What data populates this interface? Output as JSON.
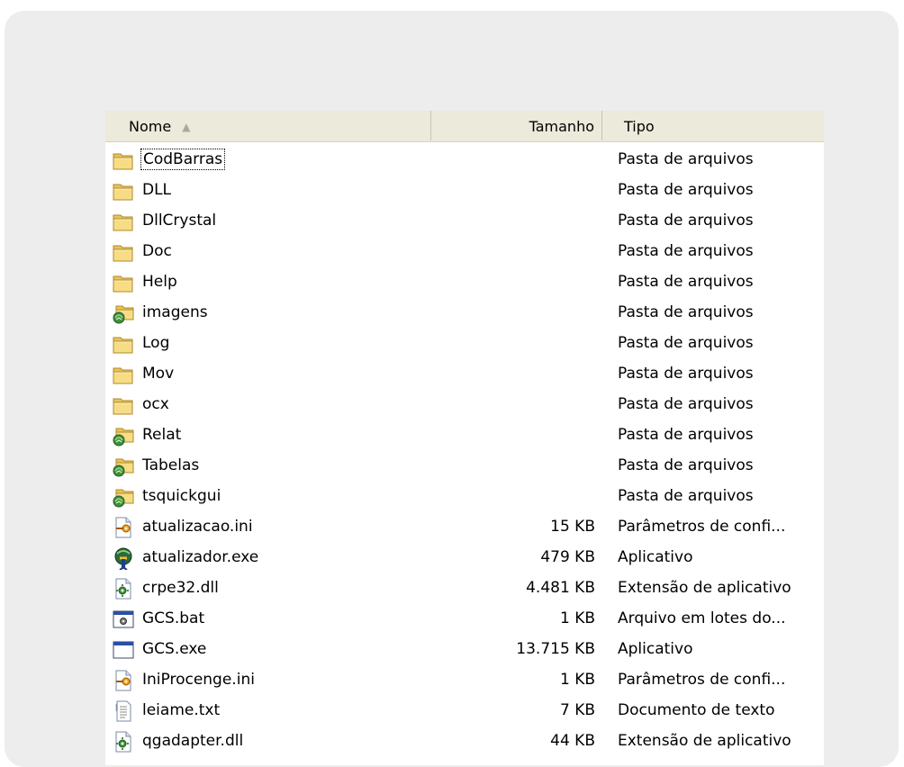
{
  "columns": {
    "name": "Nome",
    "size": "Tamanho",
    "type": "Tipo"
  },
  "files": [
    {
      "name": "CodBarras",
      "size": "",
      "type": "Pasta de arquivos",
      "icon": "folder-icon"
    },
    {
      "name": "DLL",
      "size": "",
      "type": "Pasta de arquivos",
      "icon": "folder-icon"
    },
    {
      "name": "DllCrystal",
      "size": "",
      "type": "Pasta de arquivos",
      "icon": "folder-icon"
    },
    {
      "name": "Doc",
      "size": "",
      "type": "Pasta de arquivos",
      "icon": "folder-icon"
    },
    {
      "name": "Help",
      "size": "",
      "type": "Pasta de arquivos",
      "icon": "folder-icon"
    },
    {
      "name": "imagens",
      "size": "",
      "type": "Pasta de arquivos",
      "icon": "shared-folder-icon"
    },
    {
      "name": "Log",
      "size": "",
      "type": "Pasta de arquivos",
      "icon": "folder-icon"
    },
    {
      "name": "Mov",
      "size": "",
      "type": "Pasta de arquivos",
      "icon": "folder-icon"
    },
    {
      "name": "ocx",
      "size": "",
      "type": "Pasta de arquivos",
      "icon": "folder-icon"
    },
    {
      "name": "Relat",
      "size": "",
      "type": "Pasta de arquivos",
      "icon": "shared-folder-icon"
    },
    {
      "name": "Tabelas",
      "size": "",
      "type": "Pasta de arquivos",
      "icon": "shared-folder-icon"
    },
    {
      "name": "tsquickgui",
      "size": "",
      "type": "Pasta de arquivos",
      "icon": "shared-folder-icon"
    },
    {
      "name": "atualizacao.ini",
      "size": "15 KB",
      "type": "Parâmetros de confi...",
      "icon": "ini-file-icon"
    },
    {
      "name": "atualizador.exe",
      "size": "479 KB",
      "type": "Aplicativo",
      "icon": "updater-app-icon"
    },
    {
      "name": "crpe32.dll",
      "size": "4.481 KB",
      "type": "Extensão de aplicativo",
      "icon": "dll-file-icon"
    },
    {
      "name": "GCS.bat",
      "size": "1 KB",
      "type": "Arquivo em lotes do...",
      "icon": "batch-file-icon"
    },
    {
      "name": "GCS.exe",
      "size": "13.715 KB",
      "type": "Aplicativo",
      "icon": "exe-window-icon"
    },
    {
      "name": "IniProcenge.ini",
      "size": "1 KB",
      "type": "Parâmetros de confi...",
      "icon": "ini-file-icon"
    },
    {
      "name": "leiame.txt",
      "size": "7 KB",
      "type": "Documento de texto",
      "icon": "text-file-icon"
    },
    {
      "name": "qgadapter.dll",
      "size": "44 KB",
      "type": "Extensão de aplicativo",
      "icon": "dll-file-icon"
    }
  ]
}
